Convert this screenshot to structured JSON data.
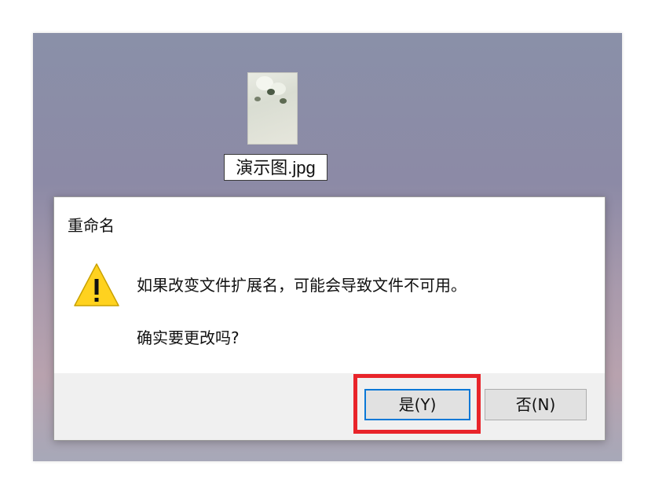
{
  "desktop": {
    "file_name": "演示图.jpg"
  },
  "dialog": {
    "title": "重命名",
    "message": "如果改变文件扩展名，可能会导致文件不可用。",
    "question": "确实要更改吗?",
    "yes_label": "是(Y)",
    "no_label": "否(N)",
    "icon": "warning-icon"
  },
  "colors": {
    "highlight": "#e8242a",
    "focus_border": "#0a78d7",
    "warning_fill": "#ffd21f"
  }
}
